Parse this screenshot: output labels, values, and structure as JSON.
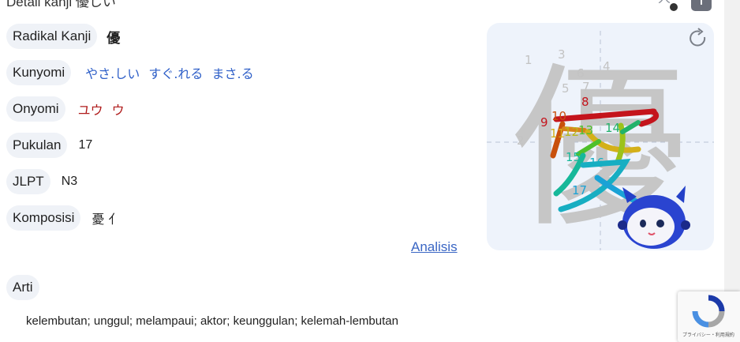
{
  "header": {
    "title": "Detail kanji 優しい"
  },
  "fields": [
    {
      "label": "Radikal Kanji",
      "value": "優"
    },
    {
      "label": "Kunyomi",
      "value": "やさ.しい すぐ.れる まさ.る"
    },
    {
      "label": "Onyomi",
      "value": "ユウ ウ"
    },
    {
      "label": "Pukulan",
      "value": "17"
    },
    {
      "label": "JLPT",
      "value": "N3"
    },
    {
      "label": "Komposisi",
      "value": "憂 亻"
    }
  ],
  "analisis_link": "Analisis",
  "arti": {
    "label": "Arti",
    "text": "kelembutan; unggul; melampaui; aktor; keunggulan; kelemah-lembutan"
  },
  "stroke_panel": {
    "character": "優",
    "stroke_numbers": [
      "1",
      "2",
      "3",
      "4",
      "5",
      "6",
      "7",
      "8",
      "9",
      "10",
      "11",
      "12",
      "13",
      "14",
      "15",
      "16",
      "17"
    ]
  },
  "recaptcha": {
    "footer": "プライバシー・利用規約"
  },
  "colors": {
    "kunyomi": "#2e5fc8",
    "onyomi": "#b01c1c",
    "pill_bg": "#eff2f7",
    "panel_bg": "#eef3fb",
    "link": "#3a66c4"
  },
  "icons": [
    "voice-icon",
    "add-icon",
    "refresh-icon",
    "mascot-icon",
    "recaptcha-icon"
  ]
}
